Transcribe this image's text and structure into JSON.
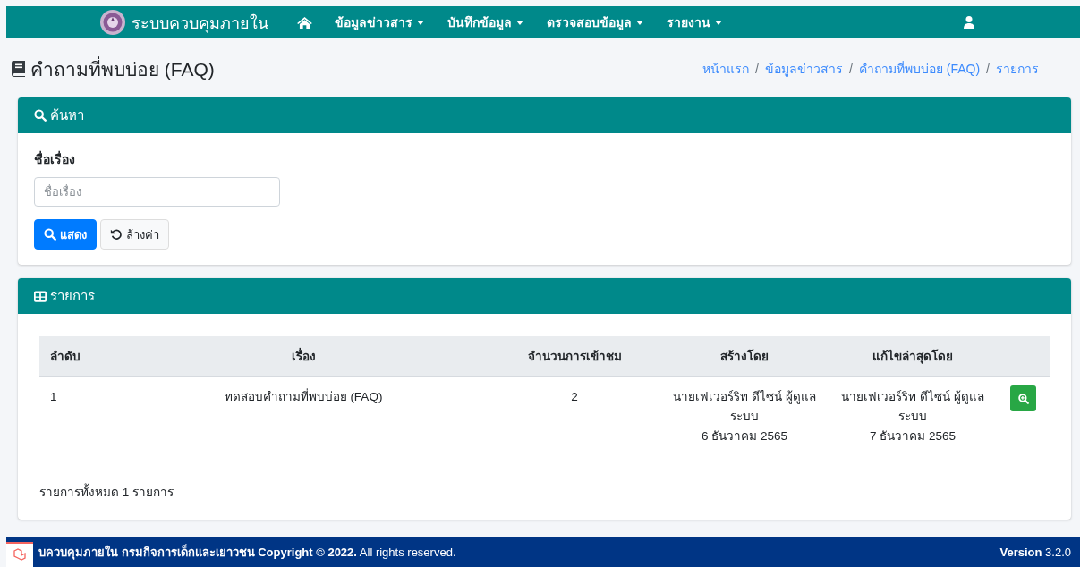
{
  "navbar": {
    "brand": "ระบบควบคุมภายใน",
    "menus": [
      {
        "label": "ข้อมูลข่าวสาร"
      },
      {
        "label": "บันทึกข้อมูล"
      },
      {
        "label": "ตรวจสอบข้อมูล"
      },
      {
        "label": "รายงาน"
      }
    ]
  },
  "page": {
    "title": "คำถามที่พบบ่อย (FAQ)",
    "breadcrumb_separator": "/",
    "breadcrumb": [
      {
        "label": "หน้าแรก"
      },
      {
        "label": "ข้อมูลข่าวสาร"
      },
      {
        "label": "คำถามที่พบบ่อย (FAQ)"
      },
      {
        "label": "รายการ"
      }
    ]
  },
  "search": {
    "title": "ค้นหา",
    "field_label": "ชื่อเรื่อง",
    "placeholder": "ชื่อเรื่อง",
    "buttons": [
      {
        "kind": "primary",
        "label": "แสดง"
      },
      {
        "kind": "reset",
        "label": "ล้างค่า"
      }
    ]
  },
  "list": {
    "title": "รายการ",
    "table": {
      "columns": [
        "ลำดับ",
        "เรื่อง",
        "จำนวนการเข้าชม",
        "สร้างโดย",
        "แก้ไขล่าสุดโดย"
      ],
      "rows": [
        {
          "index": "1",
          "subject": "ทดสอบคำถามที่พบบ่อย (FAQ)",
          "views": "2",
          "created": {
            "name": "นายเฟเวอร์ริท ดีไซน์ ผู้ดูแลระบบ",
            "date": "6 ธันวาคม 2565"
          },
          "updated": {
            "name": "นายเฟเวอร์ริท ดีไซน์ ผู้ดูแลระบบ",
            "date": "7 ธันวาคม 2565"
          }
        }
      ]
    },
    "summary": "รายการทั้งหมด 1 รายการ"
  },
  "footer": {
    "copyright": "**บควบคุมภายใน กรมกิจการเด็กและเยาวชน Copyright © 2022.** All rights reserved.",
    "version": "**Version** 3.2.0"
  }
}
